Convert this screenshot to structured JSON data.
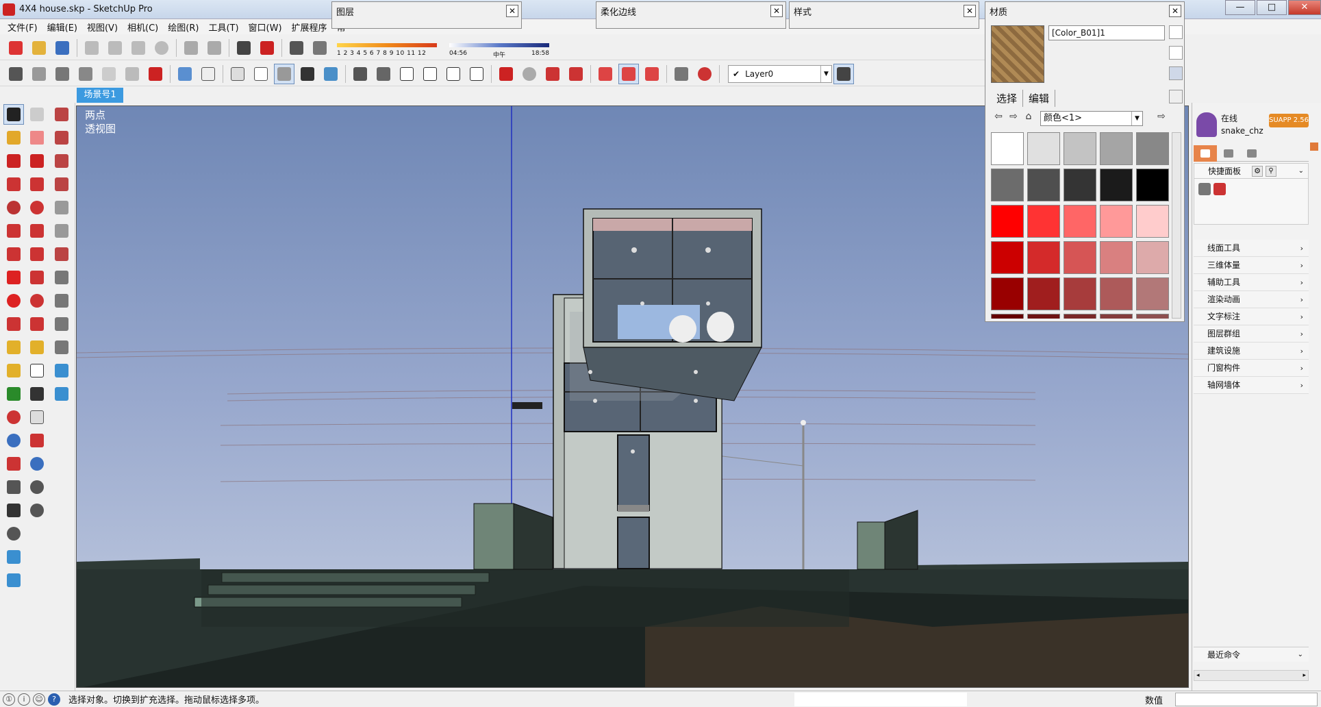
{
  "window": {
    "title": "4X4 house.skp - SketchUp Pro",
    "minimize": "—",
    "restore": "□",
    "close": "✕"
  },
  "menu": [
    "文件(F)",
    "编辑(E)",
    "视图(V)",
    "相机(C)",
    "绘图(R)",
    "工具(T)",
    "窗口(W)",
    "扩展程序",
    "帮"
  ],
  "toolbar": {
    "shadow_numbers": "1 2 3 4 5 6 7 8 9 10 11 12",
    "time_start": "04:56",
    "time_mid": "中午",
    "time_end": "18:58",
    "layer": "Layer0",
    "layer_check": "✔"
  },
  "panels": {
    "layers": "图层",
    "soften": "柔化边线",
    "styles": "样式",
    "close": "✕"
  },
  "materials": {
    "title": "材质",
    "name": "[Color_B01]1",
    "tab_select": "选择",
    "tab_edit": "编辑",
    "collection": "颜色<1>",
    "nav_back": "⇦",
    "nav_forward": "⇨",
    "nav_home": "⌂",
    "nav_details": "⇨",
    "swatches": [
      "#ffffff",
      "#e0e0e0",
      "#c3c3c3",
      "#a5a5a5",
      "#888888",
      "#6c6c6c",
      "#4f4f4f",
      "#343434",
      "#1b1b1b",
      "#000000",
      "#ff0000",
      "#ff3333",
      "#ff6666",
      "#ff9999",
      "#ffcccc",
      "#cc0000",
      "#d42a2a",
      "#d65555",
      "#d98080",
      "#ddaaaa",
      "#990000",
      "#a01e1e",
      "#a73c3c",
      "#ad5a5a",
      "#b27878",
      "#660000",
      "#6e1414",
      "#7a2828",
      "#843c3c",
      "#8e5050"
    ]
  },
  "viewport": {
    "scene_tab": "场景号1",
    "label_line1": "两点",
    "label_line2": "透视图"
  },
  "plugin": {
    "status": "在线",
    "user": "snake_chz",
    "badge": "SUAPP 2.56",
    "quick_panel": "快捷面板",
    "gear": "⚙",
    "search": "⚲",
    "chev_down": "⌄",
    "chev_right": "›",
    "categories": [
      "线面工具",
      "三维体量",
      "辅助工具",
      "渲染动画",
      "文字标注",
      "图层群组",
      "建筑设施",
      "门窗构件",
      "轴网墙体"
    ],
    "recent": "最近命令",
    "scroll_left": "◂",
    "scroll_right": "▸"
  },
  "status": {
    "hint": "选择对象。切换到扩充选择。拖动鼠标选择多项。",
    "value_label": "数值",
    "geo": "①",
    "info": "i",
    "user": "☺",
    "help": "?"
  },
  "colors": {
    "scene_tab": "#3c9ae0",
    "badge": "#e58a25",
    "axis_blue": "#2030c0"
  }
}
